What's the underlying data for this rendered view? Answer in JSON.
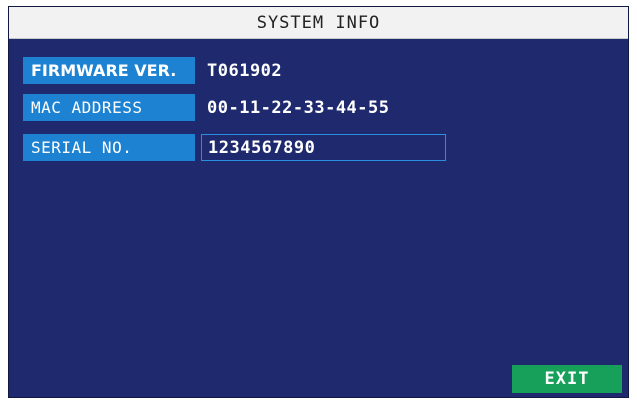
{
  "header": {
    "title": "SYSTEM INFO"
  },
  "info": {
    "rows": [
      {
        "label": "FIRMWARE VER.",
        "value": "T061902"
      },
      {
        "label": "MAC ADDRESS",
        "value": "00-11-22-33-44-55"
      },
      {
        "label": "SERIAL NO.",
        "value": "1234567890"
      }
    ]
  },
  "footer": {
    "exit_label": "EXIT"
  },
  "colors": {
    "panel_background": "#1f2a6e",
    "label_background": "#1e82d2",
    "title_background": "#f2f2f2",
    "exit_background": "#17a05a"
  }
}
